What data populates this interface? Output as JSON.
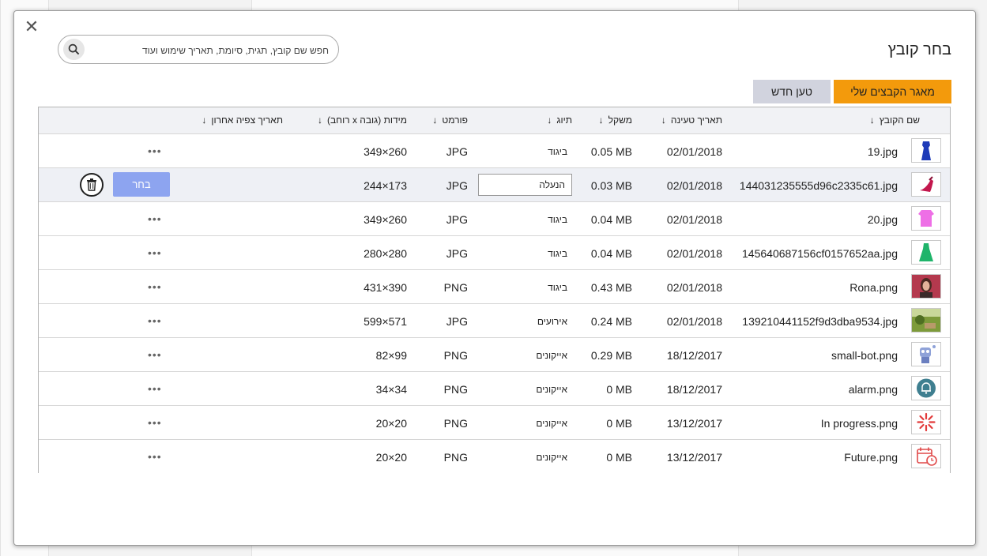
{
  "dialog": {
    "title": "בחר קובץ",
    "close_label": "✕",
    "search": {
      "placeholder": "חפש שם קובץ, תגית, סיומת, תאריך שימוש ועוד",
      "value": ""
    },
    "tabs": [
      {
        "label": "מאגר הקבצים שלי",
        "active": true
      },
      {
        "label": "טען חדש",
        "active": false
      }
    ],
    "actions": {
      "select_label": "בחר",
      "more_label": "•••"
    }
  },
  "colors": {
    "accent_orange": "#f39a0c",
    "tab_grey": "#d1d3de",
    "select_blue": "#8da4f0"
  },
  "table": {
    "columns": [
      {
        "key": "name",
        "label": "שם הקובץ",
        "arrow": "↓"
      },
      {
        "key": "date",
        "label": "תאריך טעינה",
        "arrow": "↓"
      },
      {
        "key": "size",
        "label": "משקל",
        "arrow": "↓"
      },
      {
        "key": "tag",
        "label": "תיוג",
        "arrow": "↓"
      },
      {
        "key": "format",
        "label": "פורמט",
        "arrow": "↓"
      },
      {
        "key": "dimensions",
        "label": "מידות (גובה x רוחב)",
        "arrow": "↓"
      },
      {
        "key": "last_viewed",
        "label": "תאריך צפיה אחרון",
        "arrow": "↓"
      }
    ],
    "rows": [
      {
        "thumb": "blue-dress",
        "name": "19.jpg",
        "date": "02/01/2018",
        "size": "0.05 MB",
        "tag": "ביגוד",
        "format": "JPG",
        "dimensions": "349×260"
      },
      {
        "thumb": "red-shoe",
        "name": "144031235555d96c2335c61.jpg",
        "date": "02/01/2018",
        "size": "0.03 MB",
        "tag": "הנעלה",
        "format": "JPG",
        "dimensions": "244×173",
        "selected": true
      },
      {
        "thumb": "pink-shirt",
        "name": "20.jpg",
        "date": "02/01/2018",
        "size": "0.04 MB",
        "tag": "ביגוד",
        "format": "JPG",
        "dimensions": "349×260"
      },
      {
        "thumb": "green-dress",
        "name": "145640687156cf0157652aa.jpg",
        "date": "02/01/2018",
        "size": "0.04 MB",
        "tag": "ביגוד",
        "format": "JPG",
        "dimensions": "280×280"
      },
      {
        "thumb": "portrait-photo",
        "name": "Rona.png",
        "date": "02/01/2018",
        "size": "0.43 MB",
        "tag": "ביגוד",
        "format": "PNG",
        "dimensions": "431×390"
      },
      {
        "thumb": "garden-photo",
        "name": "139210441152f9d3dba9534.jpg",
        "date": "02/01/2018",
        "size": "0.24 MB",
        "tag": "אירועים",
        "format": "JPG",
        "dimensions": "599×571"
      },
      {
        "thumb": "robot-icon",
        "name": "small-bot.png",
        "date": "18/12/2017",
        "size": "0.29 MB",
        "tag": "אייקונים",
        "format": "PNG",
        "dimensions": "82×99"
      },
      {
        "thumb": "bell-icon",
        "name": "alarm.png",
        "date": "18/12/2017",
        "size": "0 MB",
        "tag": "אייקונים",
        "format": "PNG",
        "dimensions": "34×34"
      },
      {
        "thumb": "spinner-icon",
        "name": "In progress.png",
        "date": "13/12/2017",
        "size": "0 MB",
        "tag": "אייקונים",
        "format": "PNG",
        "dimensions": "20×20"
      },
      {
        "thumb": "calendar-clock-icon",
        "name": "Future.png",
        "date": "13/12/2017",
        "size": "0 MB",
        "tag": "אייקונים",
        "format": "PNG",
        "dimensions": "20×20"
      }
    ]
  }
}
